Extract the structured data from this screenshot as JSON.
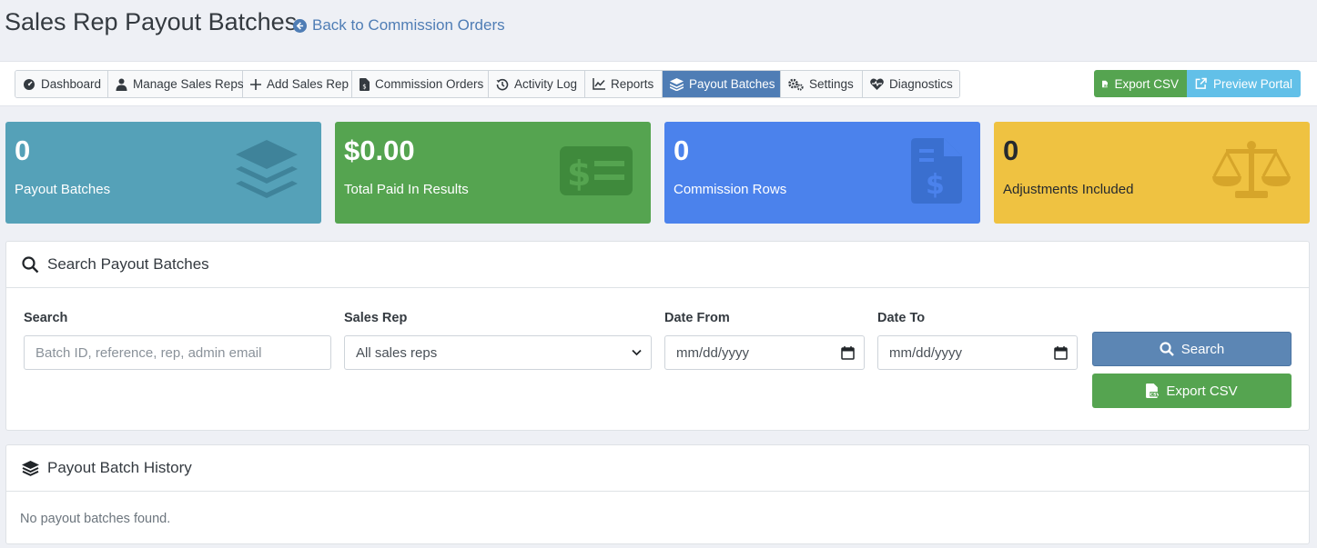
{
  "page": {
    "title": "Sales Rep Payout Batches",
    "back_link": "Back to Commission Orders"
  },
  "nav": {
    "items": [
      {
        "label": "Dashboard",
        "icon": "dashboard-icon"
      },
      {
        "label": "Manage Sales Reps",
        "icon": "user-tie-icon"
      },
      {
        "label": "Add Sales Rep",
        "icon": "plus-icon"
      },
      {
        "label": "Commission Orders",
        "icon": "file-invoice-dollar-icon"
      },
      {
        "label": "Activity Log",
        "icon": "history-icon"
      },
      {
        "label": "Reports",
        "icon": "chart-line-icon"
      },
      {
        "label": "Payout Batches",
        "icon": "layer-group-icon",
        "active": true
      },
      {
        "label": "Settings",
        "icon": "cogs-icon"
      },
      {
        "label": "Diagnostics",
        "icon": "heartbeat-icon"
      }
    ],
    "export_csv": "Export CSV",
    "preview_portal": "Preview Portal"
  },
  "stats": [
    {
      "value": "0",
      "label": "Payout Batches",
      "icon": "layers-icon",
      "color": "#55a1b8"
    },
    {
      "value": "$0.00",
      "label": "Total Paid In Results",
      "icon": "money-bill-icon",
      "color": "#55a450"
    },
    {
      "value": "0",
      "label": "Commission Rows",
      "icon": "file-invoice-dollar-icon",
      "color": "#4b82ec"
    },
    {
      "value": "0",
      "label": "Adjustments Included",
      "icon": "balance-scale-icon",
      "color": "#efc241"
    }
  ],
  "search": {
    "title": "Search Payout Batches",
    "search_label": "Search",
    "search_placeholder": "Batch ID, reference, rep, admin email",
    "rep_label": "Sales Rep",
    "rep_selected": "All sales reps",
    "date_from_label": "Date From",
    "date_from_value": "mm/dd/yyyy",
    "date_to_label": "Date To",
    "date_to_value": "mm/dd/yyyy",
    "search_button": "Search",
    "export_button": "Export CSV"
  },
  "history": {
    "title": "Payout Batch History",
    "empty_text": "No payout batches found."
  },
  "colors": {
    "accent": "#4f7db5",
    "success": "#55a450",
    "info": "#62c0e8",
    "warning": "#efc241",
    "primary": "#4b82ec"
  }
}
